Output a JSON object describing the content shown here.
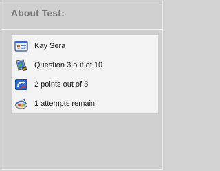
{
  "panel": {
    "title": "About Test:"
  },
  "info": {
    "user_name": "Kay Sera",
    "question_progress": "Question 3 out of 10",
    "score": "2  points out of  3",
    "attempts": "1 attempts remain"
  },
  "icons": {
    "user": "id-card-icon",
    "question": "question-sheet-icon",
    "score": "score-arrow-icon",
    "attempts": "attempts-icon"
  },
  "colors": {
    "background": "#d2d2d2",
    "info_box": "#f3f3f3",
    "title_text": "#767676"
  }
}
